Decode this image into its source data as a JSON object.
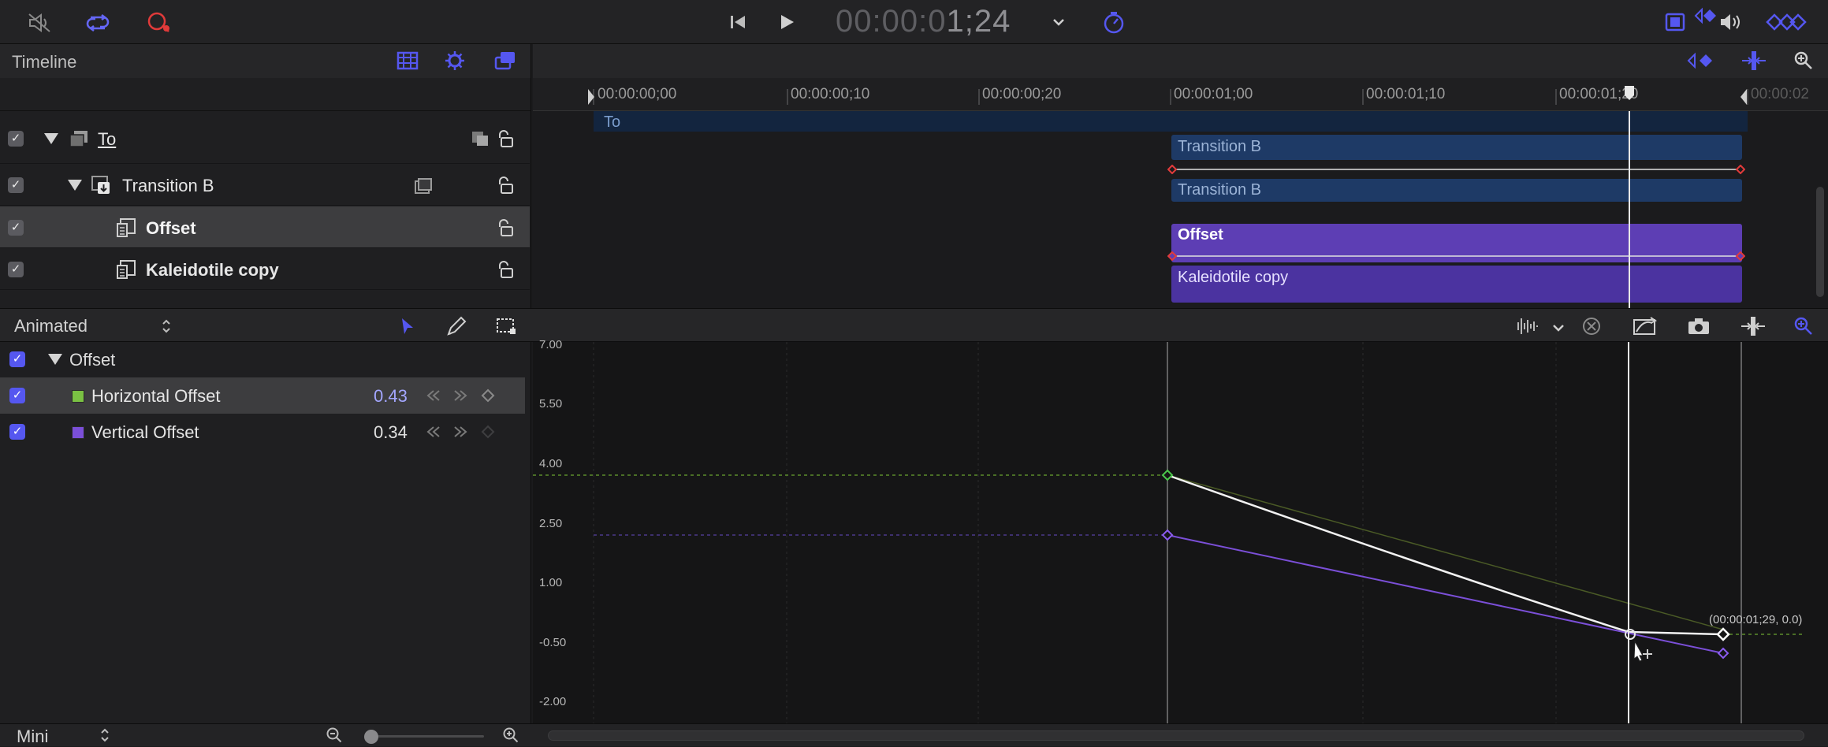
{
  "toolbar": {
    "timecode_dim": "00:00:0",
    "timecode_bright": "1;24"
  },
  "timeline_panel": {
    "title": "Timeline"
  },
  "ruler": {
    "ticks": [
      "00:00:00;00",
      "00:00:00;10",
      "00:00:00;20",
      "00:00:01;00",
      "00:00:01;10",
      "00:00:01;20",
      "00:00:02"
    ]
  },
  "layers": [
    {
      "name": "To",
      "checked": true
    },
    {
      "name": "Transition B",
      "checked": true
    },
    {
      "name": "Offset",
      "checked": true,
      "selected": true
    },
    {
      "name": "Kaleidotile copy",
      "checked": true
    }
  ],
  "timeline_bars": {
    "to": "To",
    "transition_b_1": "Transition B",
    "transition_b_2": "Transition B",
    "offset": "Offset",
    "kaleidotile": "Kaleidotile copy"
  },
  "keyframe_editor": {
    "filter_label": "Animated",
    "group_label": "Offset",
    "params": [
      {
        "name": "Horizontal Offset",
        "value": "0.43",
        "color": "#7ac143"
      },
      {
        "name": "Vertical Offset",
        "value": "0.34",
        "color": "#7b4fd8"
      }
    ],
    "y_labels": [
      "7.00",
      "5.50",
      "4.00",
      "2.50",
      "1.00",
      "-0.50",
      "-2.00"
    ],
    "tooltip": "(00:00:01;29, 0.0)"
  },
  "bottom": {
    "size_label": "Mini"
  },
  "colors": {
    "accent": "#5557f0",
    "bar_blue": "#1e3a66",
    "bar_purple": "#5d3eb4",
    "keyframe_red": "#e23b3b",
    "horizontal_curve": "#7ac143",
    "vertical_curve": "#7b4fd8"
  }
}
